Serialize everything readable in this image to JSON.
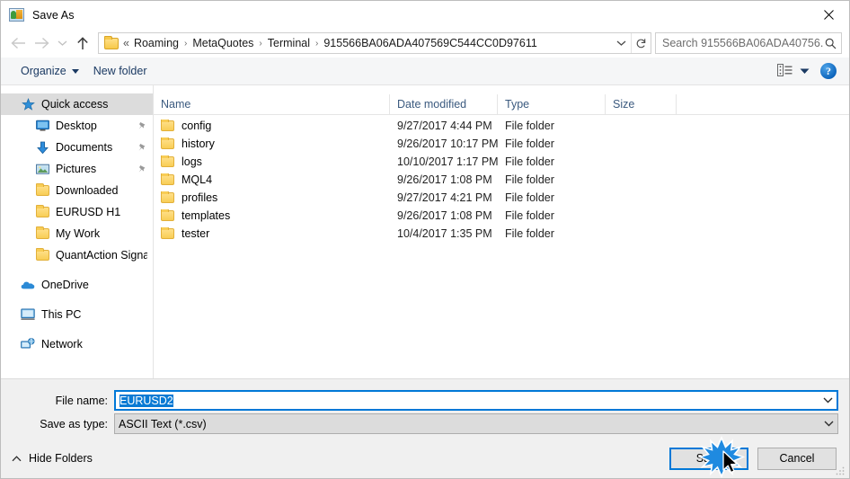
{
  "window": {
    "title": "Save As",
    "app_icon": "save-as-icon",
    "close_label": "✕"
  },
  "nav": {
    "back": "back-arrow",
    "forward": "forward-arrow",
    "recent": "recent-locations-chevron",
    "up": "up-arrow",
    "breadcrumb_prefix": "«",
    "breadcrumbs": [
      "Roaming",
      "MetaQuotes",
      "Terminal",
      "915566BA06ADA407569C544CC0D97611"
    ],
    "separator": "›",
    "dropdown": "chevron-down-icon",
    "refresh": "refresh-icon"
  },
  "search": {
    "placeholder": "Search 915566BA06ADA40756...",
    "icon": "search-icon"
  },
  "toolbar": {
    "organize_label": "Organize",
    "new_folder_label": "New folder",
    "view_icon": "view-layout-icon",
    "view_caret": "chevron-down-icon",
    "help_label": "?",
    "help_icon": "help-icon"
  },
  "sidebar": {
    "items": [
      {
        "label": "Quick access",
        "icon": "star-icon",
        "indent": 0,
        "selected": true,
        "pinned": false
      },
      {
        "label": "Desktop",
        "icon": "monitor-icon",
        "indent": 1,
        "selected": false,
        "pinned": true
      },
      {
        "label": "Documents",
        "icon": "download-arrow-icon",
        "indent": 1,
        "selected": false,
        "pinned": true
      },
      {
        "label": "Pictures",
        "icon": "picture-icon",
        "indent": 1,
        "selected": false,
        "pinned": true
      },
      {
        "label": "Downloaded",
        "icon": "folder-icon",
        "indent": 1,
        "selected": false,
        "pinned": false
      },
      {
        "label": "EURUSD H1",
        "icon": "folder-icon",
        "indent": 1,
        "selected": false,
        "pinned": false
      },
      {
        "label": "My Work",
        "icon": "folder-icon",
        "indent": 1,
        "selected": false,
        "pinned": false
      },
      {
        "label": "QuantAction Signal",
        "icon": "folder-icon",
        "indent": 1,
        "selected": false,
        "pinned": false
      },
      {
        "label": "OneDrive",
        "icon": "cloud-icon",
        "indent": 0,
        "selected": false,
        "pinned": false,
        "gap_before": true
      },
      {
        "label": "This PC",
        "icon": "computer-icon",
        "indent": 0,
        "selected": false,
        "pinned": false,
        "gap_before": true
      },
      {
        "label": "Network",
        "icon": "network-icon",
        "indent": 0,
        "selected": false,
        "pinned": false,
        "gap_before": true
      }
    ]
  },
  "filelist": {
    "columns": [
      "Name",
      "Date modified",
      "Type",
      "Size"
    ],
    "sort_column": "Name",
    "sort_caret": "˄",
    "rows": [
      {
        "name": "config",
        "date": "9/27/2017 4:44 PM",
        "type": "File folder",
        "size": ""
      },
      {
        "name": "history",
        "date": "9/26/2017 10:17 PM",
        "type": "File folder",
        "size": ""
      },
      {
        "name": "logs",
        "date": "10/10/2017 1:17 PM",
        "type": "File folder",
        "size": ""
      },
      {
        "name": "MQL4",
        "date": "9/26/2017 1:08 PM",
        "type": "File folder",
        "size": ""
      },
      {
        "name": "profiles",
        "date": "9/27/2017 4:21 PM",
        "type": "File folder",
        "size": ""
      },
      {
        "name": "templates",
        "date": "9/26/2017 1:08 PM",
        "type": "File folder",
        "size": ""
      },
      {
        "name": "tester",
        "date": "10/4/2017 1:35 PM",
        "type": "File folder",
        "size": ""
      }
    ]
  },
  "form": {
    "filename_label": "File name:",
    "filename_value": "EURUSD2",
    "filename_selected": true,
    "filetype_label": "Save as type:",
    "filetype_value": "ASCII Text (*.csv)"
  },
  "footer": {
    "hide_folders_label": "Hide Folders",
    "hide_folders_caret": "˄",
    "save_label": "Save",
    "cancel_label": "Cancel"
  },
  "colors": {
    "accent": "#0078d7",
    "selection": "#0a7ad4",
    "sidebar_selected": "#dcdcdc",
    "header_text": "#3b5a7f",
    "toolbar_text": "#1b3a63",
    "folder": "#f8cd55"
  }
}
